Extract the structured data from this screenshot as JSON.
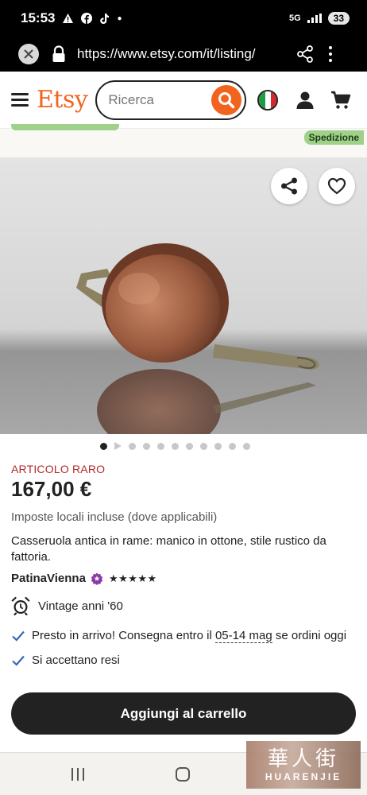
{
  "status_bar": {
    "time": "15:53",
    "network": "5G",
    "battery": "33"
  },
  "browser": {
    "url": "https://www.etsy.com/it/listing/"
  },
  "header": {
    "logo": "Etsy",
    "search_placeholder": "Ricerca"
  },
  "strip": {
    "shipping_badge": "Spedizione"
  },
  "gallery": {
    "image_count": 11,
    "active_index": 0
  },
  "product": {
    "badge": "ARTICOLO RARO",
    "price": "167,00 €",
    "tax_note": "Imposte locali incluse (dove applicabili)",
    "title": "Casseruola antica in rame: manico in ottone, stile rustico da fattoria.",
    "seller": "PatinaVienna",
    "rating_stars": "★★★★★",
    "rating": 5,
    "vintage": "Vintage anni '60",
    "delivery_prefix": "Presto in arrivo! Consegna entro il ",
    "delivery_dates": "05-14 mag",
    "delivery_suffix": " se ordini oggi",
    "returns": "Si accettano resi",
    "add_to_cart": "Aggiungi al carrello"
  },
  "watermark": {
    "chinese": "華人街",
    "latin": "HUARENJIE"
  },
  "colors": {
    "brand": "#f1641e",
    "rare": "#b02b2b",
    "button": "#222222",
    "badge_green": "#9fd18a"
  }
}
